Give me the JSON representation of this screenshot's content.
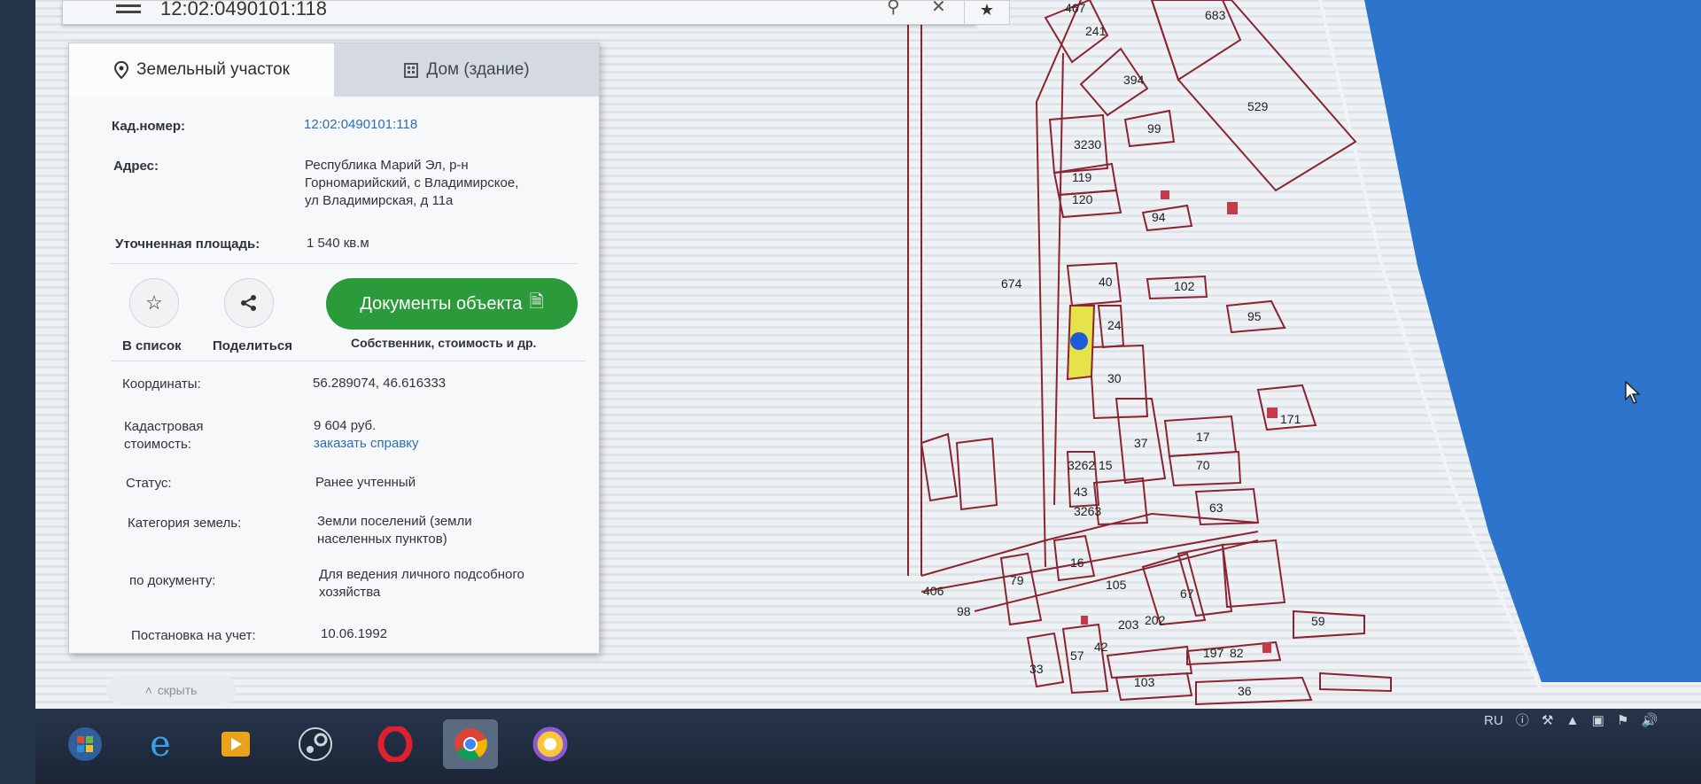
{
  "search": {
    "query": "12:02:0490101:118"
  },
  "tabs": {
    "land": "Земельный участок",
    "house": "Дом (здание)"
  },
  "info": {
    "cad_label": "Кад.номер:",
    "cad_value": "12:02:0490101:118",
    "addr_label": "Адрес:",
    "addr_line1": "Республика Марий Эл, р-н",
    "addr_line2": "Горномарийский, с Владимирское,",
    "addr_line3": "ул Владимирская, д 11а",
    "area_label": "Уточненная площадь:",
    "area_value": "1 540 кв.м"
  },
  "actions": {
    "list_label": "В список",
    "share_label": "Поделиться",
    "docs_label": "Документы объекта",
    "docs_sub": "Собственник, стоимость и др."
  },
  "details": {
    "coords_label": "Координаты:",
    "coords_value": "56.289074, 46.616333",
    "cost_label1": "Кадастровая",
    "cost_label2": "стоимость:",
    "cost_value": "9 604 руб.",
    "cost_link": "заказать справку",
    "status_label": "Статус:",
    "status_value": "Ранее учтенный",
    "cat_label": "Категория земель:",
    "cat_value1": "Земли поселений (земли",
    "cat_value2": "населенных пунктов)",
    "doc_label": "по документу:",
    "doc_value1": "Для ведения личного подсобного",
    "doc_value2": "хозяйства",
    "reg_label": "Постановка на учет:",
    "reg_value": "10.06.1992"
  },
  "hide_label": "скрыть",
  "map_labels": [
    "467",
    "241",
    "683",
    "529",
    "394",
    "99",
    "3230",
    "119",
    "120",
    "94",
    "674",
    "40",
    "102",
    "95",
    "24",
    "30",
    "17",
    "70",
    "171",
    "37",
    "15",
    "3262",
    "43",
    "3263",
    "63",
    "16",
    "79",
    "105",
    "67",
    "406",
    "98",
    "203",
    "202",
    "59",
    "42",
    "57",
    "197",
    "82",
    "33",
    "103",
    "36"
  ],
  "tray": {
    "lang": "RU"
  }
}
